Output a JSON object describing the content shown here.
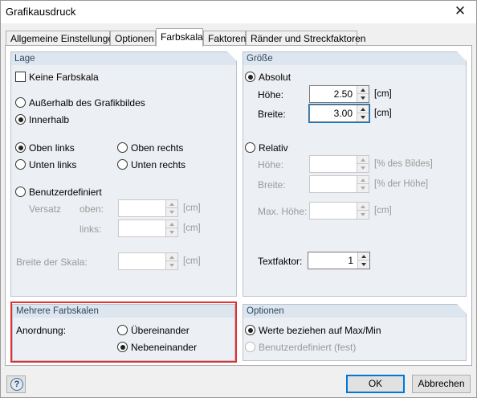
{
  "window": {
    "title": "Grafikausdruck",
    "close_glyph": "✕"
  },
  "tabs": [
    {
      "label": "Allgemeine Einstellungen"
    },
    {
      "label": "Optionen"
    },
    {
      "label": "Farbskala"
    },
    {
      "label": "Faktoren"
    },
    {
      "label": "Ränder und Streckfaktoren"
    }
  ],
  "lage": {
    "title": "Lage",
    "keine_farbskala": "Keine Farbskala",
    "ausserhalb": "Außerhalb des Grafikbildes",
    "innerhalb": "Innerhalb",
    "oben_links": "Oben links",
    "oben_rechts": "Oben rechts",
    "unten_links": "Unten links",
    "unten_rechts": "Unten rechts",
    "benutzerdefiniert": "Benutzerdefiniert",
    "versatz": "Versatz",
    "oben": "oben:",
    "links": "links:",
    "breite_der_skala": "Breite der Skala:",
    "unit_cm": "[cm]"
  },
  "groesse": {
    "title": "Größe",
    "absolut": "Absolut",
    "hoehe": "Höhe:",
    "hoehe_value": "2.50",
    "breite": "Breite:",
    "breite_value": "3.00",
    "unit_cm": "[cm]",
    "relativ": "Relativ",
    "rel_hoehe": "Höhe:",
    "rel_hoehe_unit": "[% des Bildes]",
    "rel_breite": "Breite:",
    "rel_breite_unit": "[% der Höhe]",
    "max_hoehe": "Max. Höhe:",
    "max_hoehe_unit": "[cm]",
    "textfaktor": "Textfaktor:",
    "textfaktor_value": "1"
  },
  "mehrere": {
    "title": "Mehrere Farbskalen",
    "anordnung": "Anordnung:",
    "uebereinander": "Übereinander",
    "nebeneinander": "Nebeneinander"
  },
  "optionen": {
    "title": "Optionen",
    "werte": "Werte beziehen auf Max/Min",
    "benutzerdefiniert_fest": "Benutzerdefiniert (fest)"
  },
  "footer": {
    "ok": "OK",
    "abbrechen": "Abbrechen",
    "help_glyph": "?"
  }
}
